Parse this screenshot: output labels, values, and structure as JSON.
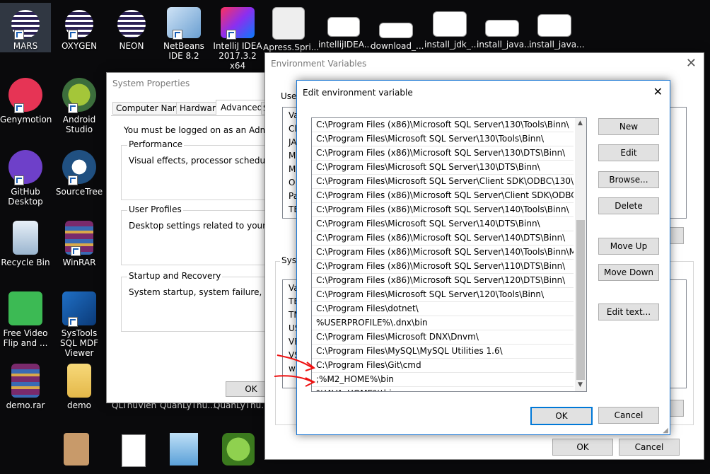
{
  "desktop": {
    "icons": [
      {
        "label": "MARS"
      },
      {
        "label": "OXYGEN"
      },
      {
        "label": "NEON"
      },
      {
        "label": "NetBeans IDE 8.2"
      },
      {
        "label": "IntelliJ IDEA 2017.3.2 x64"
      },
      {
        "label": "Apress.Spri..."
      },
      {
        "label": "intellijIDEA..."
      },
      {
        "label": "download_..."
      },
      {
        "label": "install_jdk_..."
      },
      {
        "label": "install_java..."
      },
      {
        "label": "install_java..."
      },
      {
        "label": "Genymotion"
      },
      {
        "label": "Android Studio"
      },
      {
        "label": "GitHub Desktop"
      },
      {
        "label": "SourceTree"
      },
      {
        "label": "Recycle Bin"
      },
      {
        "label": "WinRAR"
      },
      {
        "label": "Free Video Flip and ..."
      },
      {
        "label": "SysTools SQL MDF Viewer"
      },
      {
        "label": "demo.rar"
      },
      {
        "label": "demo"
      }
    ],
    "partial_labels": [
      "QLThuVien",
      "QuanLyThu...",
      "QuanLyThu..."
    ]
  },
  "system_properties": {
    "title": "System Properties",
    "tabs": [
      "Computer Name",
      "Hardware",
      "Advanced",
      "S"
    ],
    "active_tab": "Advanced",
    "admin_note": "You must be logged on as an Administrator",
    "performance": {
      "label": "Performance",
      "text": "Visual effects, processor scheduling, mem"
    },
    "user_profiles": {
      "label": "User Profiles",
      "text": "Desktop settings related to your sign-in"
    },
    "startup": {
      "label": "Startup and Recovery",
      "text": "System startup, system failure, and debug"
    },
    "ok_label": "OK"
  },
  "env_vars": {
    "title": "Environment Variables",
    "user_label": "User",
    "user_rows": [
      "Va",
      "Cl",
      "JA",
      "M",
      "M",
      "O",
      "Pa",
      "TE"
    ],
    "sys_label": "Syste",
    "sys_rows": [
      "Va",
      "TE",
      "TN",
      "US",
      "VE",
      "VS",
      "wi"
    ],
    "ok_label": "OK",
    "cancel_label": "Cancel"
  },
  "edit_dialog": {
    "title": "Edit environment variable",
    "entries": [
      "C:\\Program Files (x86)\\Microsoft SQL Server\\130\\Tools\\Binn\\",
      "C:\\Program Files\\Microsoft SQL Server\\130\\Tools\\Binn\\",
      "C:\\Program Files (x86)\\Microsoft SQL Server\\130\\DTS\\Binn\\",
      "C:\\Program Files\\Microsoft SQL Server\\130\\DTS\\Binn\\",
      "C:\\Program Files\\Microsoft SQL Server\\Client SDK\\ODBC\\130\\Tool...",
      "C:\\Program Files (x86)\\Microsoft SQL Server\\Client SDK\\ODBC\\130...",
      "C:\\Program Files (x86)\\Microsoft SQL Server\\140\\Tools\\Binn\\",
      "C:\\Program Files\\Microsoft SQL Server\\140\\DTS\\Binn\\",
      "C:\\Program Files (x86)\\Microsoft SQL Server\\140\\DTS\\Binn\\",
      "C:\\Program Files (x86)\\Microsoft SQL Server\\140\\Tools\\Binn\\Mana...",
      "C:\\Program Files (x86)\\Microsoft SQL Server\\110\\DTS\\Binn\\",
      "C:\\Program Files (x86)\\Microsoft SQL Server\\120\\DTS\\Binn\\",
      "C:\\Program Files\\Microsoft SQL Server\\120\\Tools\\Binn\\",
      "C:\\Program Files\\dotnet\\",
      "%USERPROFILE%\\.dnx\\bin",
      "C:\\Program Files\\Microsoft DNX\\Dnvm\\",
      "C:\\Program Files\\MySQL\\MySQL Utilities 1.6\\",
      "C:\\Program Files\\Git\\cmd",
      ";%M2_HOME%\\bin",
      "%JAVA_HOME%\\bin",
      ""
    ],
    "buttons": {
      "new": "New",
      "edit": "Edit",
      "browse": "Browse...",
      "delete": "Delete",
      "move_up": "Move Up",
      "move_down": "Move Down",
      "edit_text": "Edit text...",
      "ok": "OK",
      "cancel": "Cancel"
    },
    "accent": "#0078d7"
  }
}
